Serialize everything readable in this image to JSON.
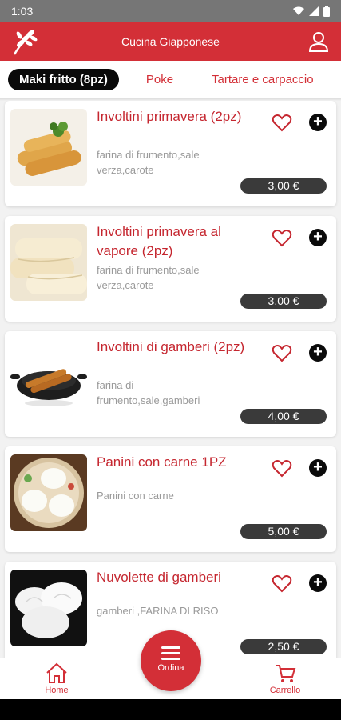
{
  "status": {
    "time": "1:03"
  },
  "header": {
    "title": "Cucina Giapponese",
    "logo_icon": "wheat-logo-icon",
    "account_icon": "account-icon"
  },
  "tabs": [
    {
      "label": "Maki fritto (8pz)",
      "active": true
    },
    {
      "label": "Poke",
      "active": false
    },
    {
      "label": "Tartare e carpaccio",
      "active": false
    }
  ],
  "items": [
    {
      "name": "Involtini primavera (2pz)",
      "desc": "farina di frumento,sale verza,carote",
      "price": "3,00 €"
    },
    {
      "name": "Involtini primavera al vapore (2pz)",
      "desc": "farina di frumento,sale verza,carote",
      "price": "3,00 €"
    },
    {
      "name": "Involtini di gamberi (2pz)",
      "desc": "farina di frumento,sale,gamberi",
      "price": "4,00 €"
    },
    {
      "name": "Panini con carne 1PZ",
      "desc": "Panini con carne",
      "price": "5,00 €"
    },
    {
      "name": "Nuvolette di gamberi",
      "desc": "gamberi ,FARINA DI RISO",
      "price": "2,50 €"
    }
  ],
  "bottom_nav": {
    "home": "Home",
    "order": "Ordina",
    "cart": "Carrello"
  },
  "colors": {
    "brand": "#d32f37",
    "price_pill": "#3a3a3a"
  }
}
